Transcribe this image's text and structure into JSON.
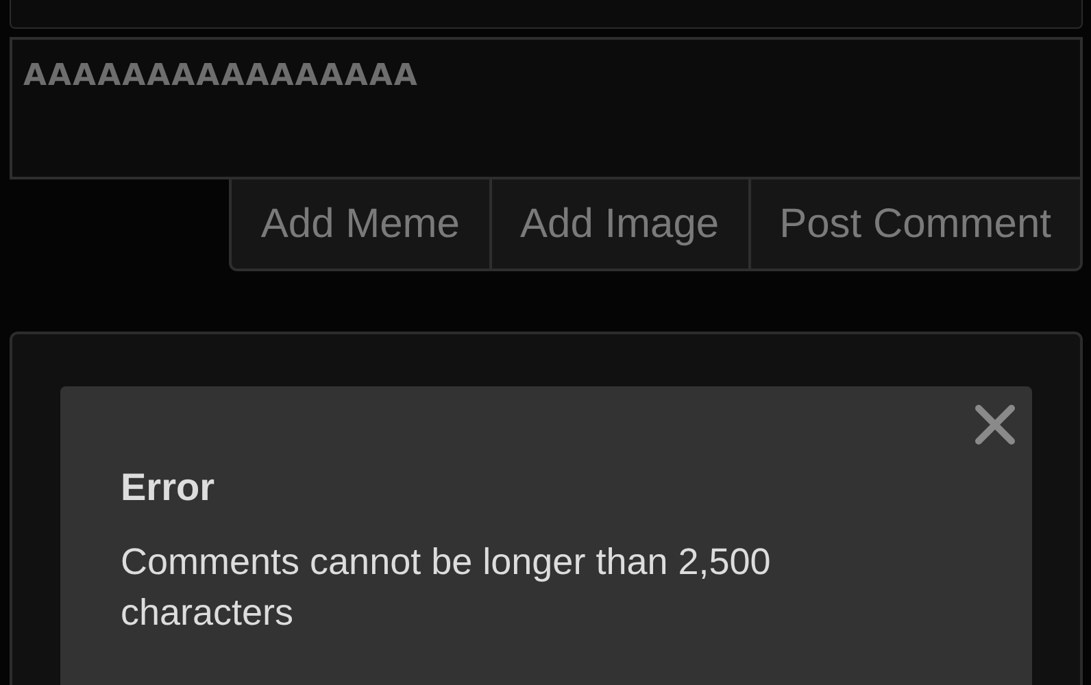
{
  "comment_box": {
    "value": "AAAAAAAAAAAAAAAA"
  },
  "buttons": [
    "Add Meme",
    "Add Image",
    "Post Comment"
  ],
  "dialog": {
    "title": "Error",
    "message": "Comments cannot be longer than 2,500 characters"
  }
}
